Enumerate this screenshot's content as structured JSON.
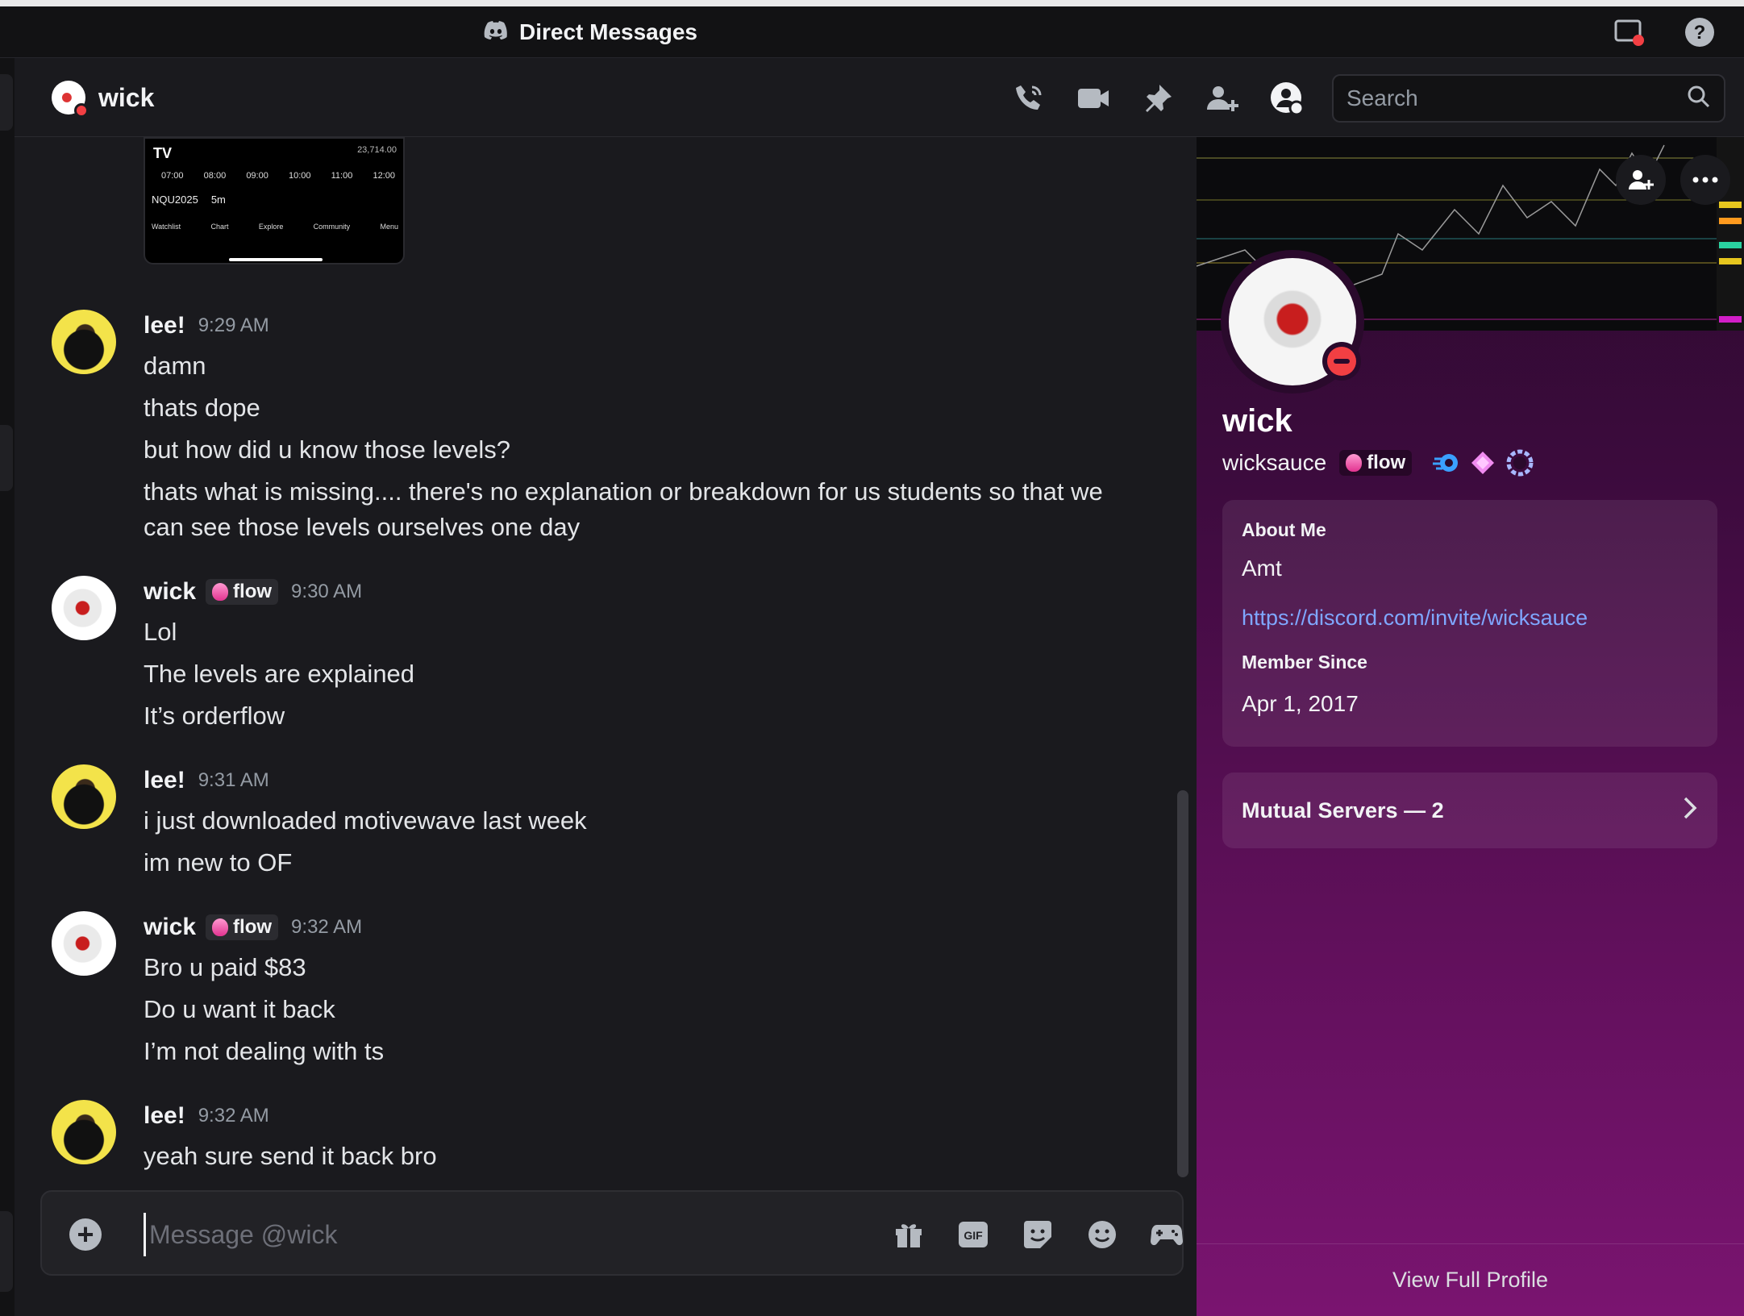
{
  "window": {
    "title": "Direct Messages"
  },
  "header": {
    "recipient": "wick",
    "search_placeholder": "Search"
  },
  "thumbnail": {
    "price": "23,714.00",
    "times": [
      "07:00",
      "08:00",
      "09:00",
      "10:00",
      "11:00",
      "12:00"
    ],
    "symbol": "NQU2025",
    "interval": "5m",
    "tabs": [
      "Watchlist",
      "Chart",
      "Explore",
      "Community",
      "Menu"
    ]
  },
  "messages": [
    {
      "user": "lee!",
      "time": "9:29 AM",
      "avatar": "lee",
      "lines": [
        "damn",
        "thats dope",
        "but how did u know those levels?",
        "thats what is missing.... there's no explanation or breakdown for us students so that we can see those levels ourselves one day"
      ]
    },
    {
      "user": "wick",
      "tag": "flow",
      "time": "9:30 AM",
      "avatar": "wick",
      "lines": [
        "Lol",
        "The levels are explained",
        "It’s orderflow"
      ]
    },
    {
      "user": "lee!",
      "time": "9:31 AM",
      "avatar": "lee",
      "lines": [
        "i just downloaded motivewave last week",
        "im new to OF"
      ]
    },
    {
      "user": "wick",
      "tag": "flow",
      "time": "9:32 AM",
      "avatar": "wick",
      "lines": [
        "Bro u paid $83",
        "Do u want it back",
        "I’m not dealing with ts"
      ]
    },
    {
      "user": "lee!",
      "time": "9:32 AM",
      "avatar": "lee",
      "lines": [
        "yeah sure send it back bro"
      ]
    }
  ],
  "composer": {
    "placeholder": "Message @wick"
  },
  "profile": {
    "display_name": "wick",
    "username": "wicksauce",
    "tag": "flow",
    "about_heading": "About Me",
    "about_text": "Amt",
    "about_link": "https://discord.com/invite/wicksauce",
    "member_since_heading": "Member Since",
    "member_since": "Apr 1, 2017",
    "mutual_servers": "Mutual Servers — 2",
    "view_full_profile": "View Full Profile"
  },
  "colors": {
    "accent_link": "#7fa7ff",
    "dnd": "#f23f43",
    "profile_gradient_top": "#2a0a2c",
    "profile_gradient_bottom": "#7a1470"
  },
  "icons": [
    "discord-icon",
    "screen-share-icon",
    "help-icon",
    "phone-icon",
    "video-icon",
    "pin-icon",
    "add-friend-icon",
    "user-profile-icon",
    "search-icon",
    "plus-icon",
    "gift-icon",
    "gif-icon",
    "sticker-icon",
    "emoji-icon",
    "activity-icon",
    "chevron-right-icon",
    "more-icon"
  ]
}
